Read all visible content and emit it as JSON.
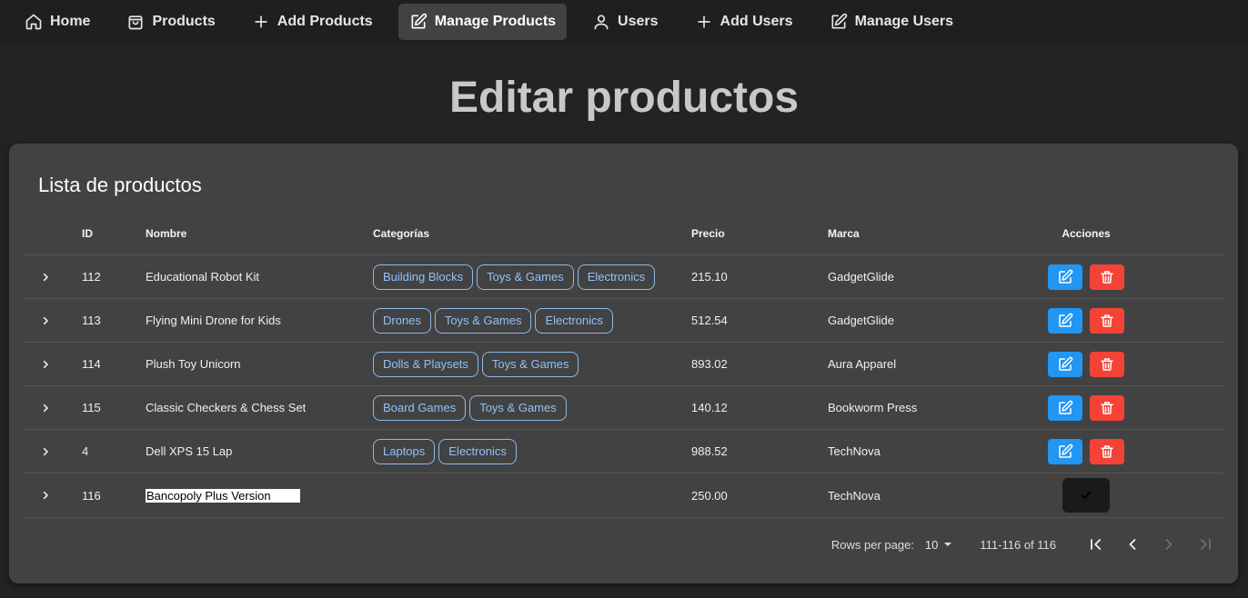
{
  "nav": {
    "items": [
      {
        "label": "Home",
        "icon": "home-icon",
        "active": false
      },
      {
        "label": "Products",
        "icon": "shopping-bag-icon",
        "active": false
      },
      {
        "label": "Add Products",
        "icon": "plus-icon",
        "active": false
      },
      {
        "label": "Manage Products",
        "icon": "edit-icon",
        "active": true
      },
      {
        "label": "Users",
        "icon": "user-icon",
        "active": false
      },
      {
        "label": "Add Users",
        "icon": "plus-icon",
        "active": false
      },
      {
        "label": "Manage Users",
        "icon": "edit-icon",
        "active": false
      }
    ]
  },
  "page": {
    "title": "Editar productos"
  },
  "card": {
    "title": "Lista de productos"
  },
  "table": {
    "headers": {
      "id": "ID",
      "name": "Nombre",
      "categories": "Categorías",
      "price": "Precio",
      "brand": "Marca",
      "actions": "Acciones"
    },
    "rows": [
      {
        "id": "112",
        "name": "Educational Robot Kit",
        "categories": [
          "Building Blocks",
          "Toys & Games",
          "Electronics"
        ],
        "price": "215.10",
        "brand": "GadgetGlide"
      },
      {
        "id": "113",
        "name": "Flying Mini Drone for Kids",
        "categories": [
          "Drones",
          "Toys & Games",
          "Electronics"
        ],
        "price": "512.54",
        "brand": "GadgetGlide"
      },
      {
        "id": "114",
        "name": "Plush Toy Unicorn",
        "categories": [
          "Dolls & Playsets",
          "Toys & Games"
        ],
        "price": "893.02",
        "brand": "Aura Apparel"
      },
      {
        "id": "115",
        "name": "Classic Checkers & Chess Set",
        "categories": [
          "Board Games",
          "Toys & Games"
        ],
        "price": "140.12",
        "brand": "Bookworm Press"
      },
      {
        "id": "4",
        "name": "Dell XPS 15 Lap",
        "categories": [
          "Laptops",
          "Electronics"
        ],
        "price": "988.52",
        "brand": "TechNova"
      }
    ],
    "editing_row": {
      "id": "116",
      "name_value": "Bancopoly Plus Version",
      "price": "250.00",
      "brand": "TechNova"
    }
  },
  "pagination": {
    "rows_per_page_label": "Rows per page:",
    "rows_per_page_value": "10",
    "range": "111-116 of 116"
  },
  "colors": {
    "background": "#232323",
    "nav_background": "#1f1f1f",
    "nav_active": "#424242",
    "card": "#424242",
    "chip_border": "#8fb8e8",
    "chip_text": "#90c2f9",
    "edit_button": "#2196f3",
    "delete_button": "#f44336"
  }
}
